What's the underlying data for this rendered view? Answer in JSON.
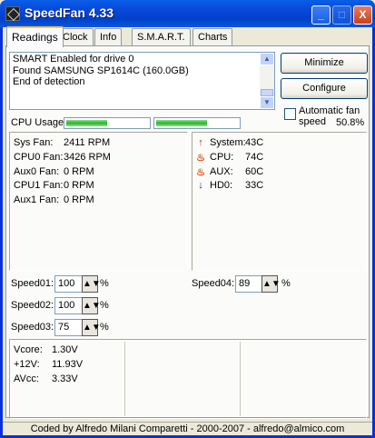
{
  "window": {
    "title": "SpeedFan 4.33",
    "min_glyph": "_",
    "max_glyph": "□",
    "close_glyph": "X"
  },
  "tabs": [
    "Readings",
    "Clock",
    "Info",
    "S.M.A.R.T.",
    "Charts"
  ],
  "log": {
    "lines": [
      "SMART Enabled for drive 0",
      "Found SAMSUNG SP1614C (160.0GB)",
      "End of detection"
    ]
  },
  "buttons": {
    "minimize": "Minimize",
    "configure": "Configure"
  },
  "auto_fan": {
    "label": "Automatic fan speed",
    "checked": false
  },
  "cpu_usage": {
    "label": "CPU Usage",
    "percent": "50.8%",
    "bar1_level": 0.5,
    "bar2_level": 0.62
  },
  "fans": [
    {
      "label": "Sys Fan:",
      "value": "2411 RPM"
    },
    {
      "label": "CPU0 Fan:",
      "value": "3426 RPM"
    },
    {
      "label": "Aux0 Fan:",
      "value": "0 RPM"
    },
    {
      "label": "CPU1 Fan:",
      "value": "0 RPM"
    },
    {
      "label": "Aux1 Fan:",
      "value": "0 RPM"
    }
  ],
  "temps": [
    {
      "icon": "up-arrow-icon",
      "glyph": "↑",
      "color": "#d01010",
      "label": "System:",
      "value": "43C"
    },
    {
      "icon": "flame-icon",
      "glyph": "♨",
      "color": "#e05010",
      "label": "CPU:",
      "value": "74C"
    },
    {
      "icon": "flame-icon",
      "glyph": "♨",
      "color": "#e05010",
      "label": "AUX:",
      "value": "60C"
    },
    {
      "icon": "down-arrow-icon",
      "glyph": "↓",
      "color": "#1030c0",
      "label": "HD0:",
      "value": "33C"
    }
  ],
  "speeds": [
    {
      "label": "Speed01:",
      "value": "100",
      "unit": "%"
    },
    {
      "label": "Speed02:",
      "value": "100",
      "unit": "%"
    },
    {
      "label": "Speed03:",
      "value": "75",
      "unit": "%"
    },
    {
      "label": "Speed04:",
      "value": "89",
      "unit": "%"
    }
  ],
  "volts": [
    {
      "label": "Vcore:",
      "value": "1.30V"
    },
    {
      "label": "+12V:",
      "value": "11.93V"
    },
    {
      "label": "AVcc:",
      "value": "3.33V"
    }
  ],
  "status_bar": "Coded by Alfredo Milani Comparetti - 2000-2007 - alfredo@almico.com"
}
